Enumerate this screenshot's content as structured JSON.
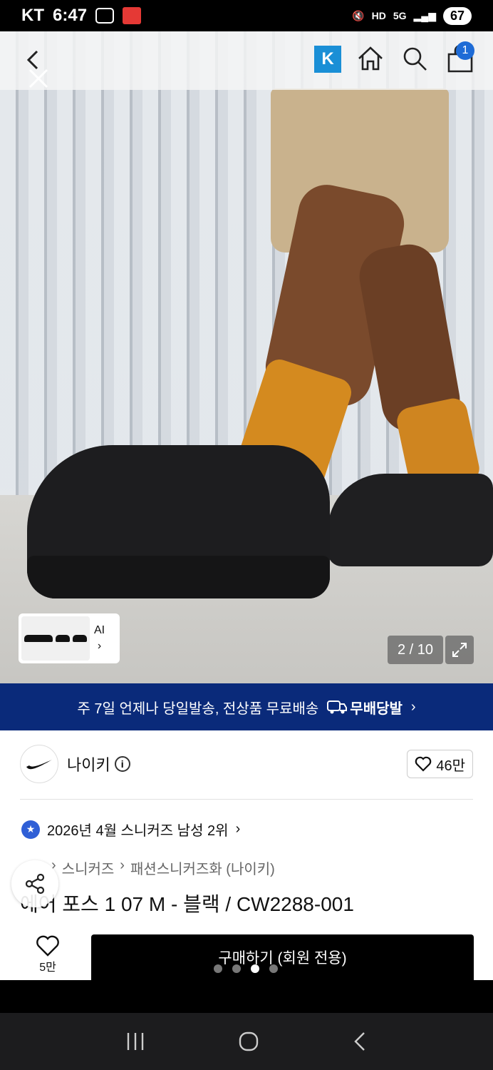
{
  "status_bar": {
    "carrier": "KT",
    "time": "6:47",
    "battery": "67",
    "indicators": [
      "mute-icon",
      "hd-icon",
      "5g-icon",
      "signal-icon"
    ]
  },
  "top_nav": {
    "k_badge": "K",
    "cart_count": "1"
  },
  "gallery": {
    "ai_label": "AI",
    "page_indicator": "2 / 10"
  },
  "delivery_banner": {
    "text": "주 7일 언제나 당일발송, 전상품 무료배송",
    "tag": "무배당발",
    "chevron": "›"
  },
  "product": {
    "brand": "나이키",
    "likes": "46만",
    "rank": "2026년 4월 스니커즈 남성 2위",
    "breadcrumb": [
      "스니커즈",
      "패션스니커즈화 (나이키)"
    ],
    "title": "에어 포스 1 07 M - 블랙 / CW2288-001"
  },
  "action_bar": {
    "wish_count": "5만",
    "buy_label": "구매하기 (회원 전용)"
  },
  "colors": {
    "banner_bg": "#0a2a7a",
    "buy_bg": "#000000",
    "k_badge_bg": "#1a8fd6",
    "cart_badge_bg": "#1e6bd6"
  }
}
